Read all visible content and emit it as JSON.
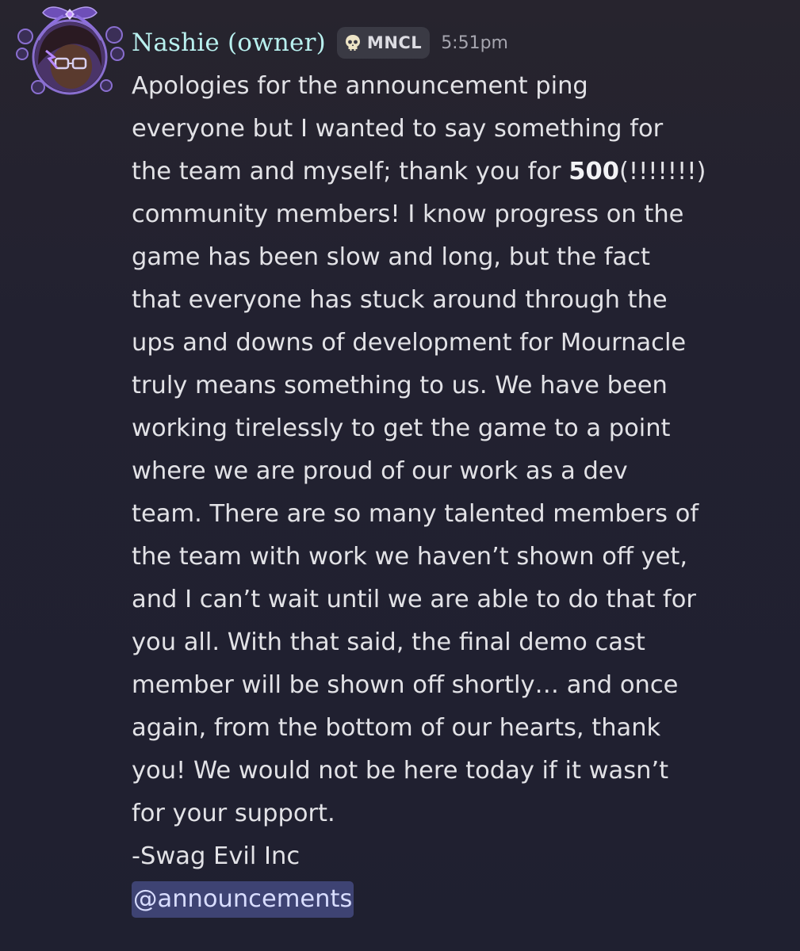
{
  "author": {
    "name": "Nashie (owner)",
    "tag": "MNCL",
    "tag_icon": "skull-icon",
    "timestamp": "5:51pm",
    "avatar": "avatar-purple-ribbon-frame"
  },
  "message": {
    "line_01": "Apologies for the announcement ping",
    "line_02": "everyone but I wanted to say something for",
    "line_03_pre": "the team and myself; thank you for ",
    "line_03_bold": "500",
    "line_03_post": "(!!!!!!!)",
    "line_04": "community members! I know progress on the",
    "line_05": "game has been slow and long, but the fact",
    "line_06": "that everyone has stuck around through the",
    "line_07": "ups and downs of development for Mournacle",
    "line_08": "truly means something to us. We have been",
    "line_09": "working tirelessly to get the game to a point",
    "line_10": "where we are proud of our work as a dev",
    "line_11": "team. There are so many talented members of",
    "line_12": "the team with work we haven’t shown off yet,",
    "line_13": "and I can’t wait until we are able to do that for",
    "line_14": "you all. With that said, the final demo cast",
    "line_15": "member will be shown off shortly… and once",
    "line_16": "again, from the bottom of our hearts, thank",
    "line_17": "you! We would not be here today if it wasn’t",
    "line_18": "for your support.",
    "line_19": "-Swag Evil Inc",
    "mention": "@announcements"
  },
  "colors": {
    "background": "#242330",
    "username": "#b8f0ee",
    "mention_bg": "#3e4373",
    "mention_text": "#d8ddff"
  }
}
